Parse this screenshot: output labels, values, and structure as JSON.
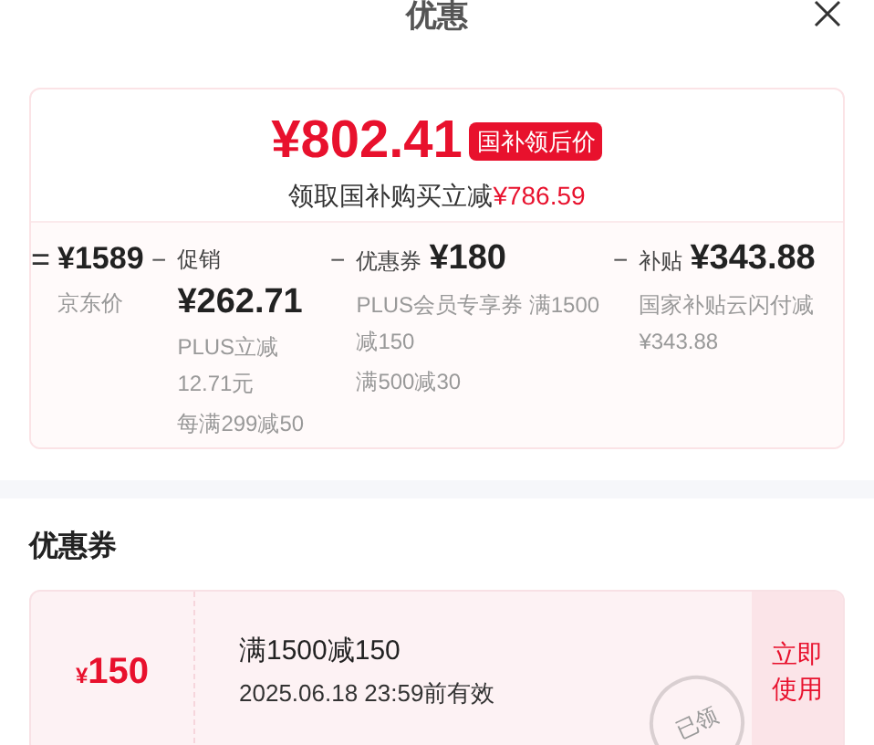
{
  "title": "优惠",
  "summary": {
    "price": "¥802.41",
    "badge": "国补领后价",
    "caption": "领取国补购买立减",
    "saving": "¥786.59"
  },
  "breakdown": [
    {
      "kind": "base",
      "operator": "=",
      "amount": "¥1589",
      "label": "京东价"
    },
    {
      "kind": "deduction",
      "operator": "−",
      "label": "促销",
      "amount": "¥262.71",
      "notes": [
        "PLUS立减12.71元",
        "每满299减50"
      ]
    },
    {
      "kind": "deduction",
      "operator": "−",
      "label": "优惠券",
      "amount": "¥180",
      "notes": [
        "PLUS会员专享券 满1500减150",
        "满500减30"
      ]
    },
    {
      "kind": "deduction",
      "operator": "−",
      "label": "补贴",
      "amount": "¥343.88",
      "notes": [
        "国家补贴云闪付减¥343.88"
      ]
    }
  ],
  "coupon_section": {
    "heading": "优惠券",
    "coupons": [
      {
        "symbol": "¥",
        "value": "150",
        "rule": "满1500减150",
        "validity": "2025.06.18 23:59前有效",
        "stamp": "已领",
        "action": "立即使用"
      }
    ]
  }
}
